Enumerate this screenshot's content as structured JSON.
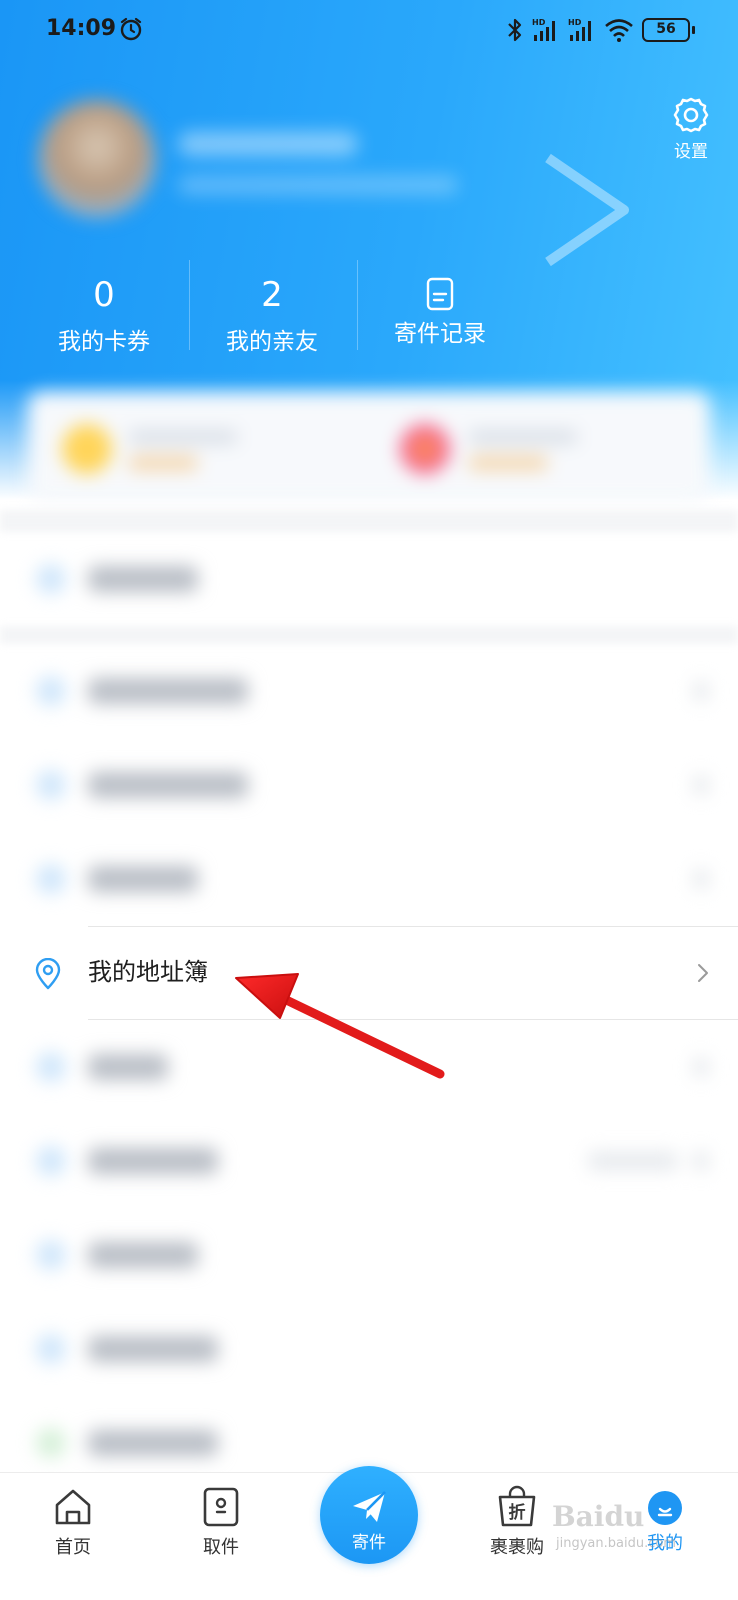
{
  "status_bar": {
    "time": "14:09",
    "battery": "56",
    "network_badge_1": "HD",
    "network_badge_2": "HD"
  },
  "header": {
    "settings_label": "设置"
  },
  "stats": [
    {
      "value": "0",
      "label": "我的卡券"
    },
    {
      "value": "2",
      "label": "我的亲友"
    },
    {
      "label": "寄件记录",
      "icon": "document-icon"
    }
  ],
  "menu": {
    "address_book_label": "我的地址簿"
  },
  "tab_bar": {
    "home": "首页",
    "pickup": "取件",
    "send": "寄件",
    "shop": "裹裹购",
    "shop_badge": "折",
    "mine": "我的"
  },
  "watermark": {
    "brand": "Bai",
    "brand_suffix": "du",
    "sub": "jingyan.baidu.com"
  },
  "colors": {
    "accent": "#1f96f3",
    "arrow": "#e21b1b",
    "header_start": "#1a96f6",
    "header_end": "#45c1ff"
  }
}
